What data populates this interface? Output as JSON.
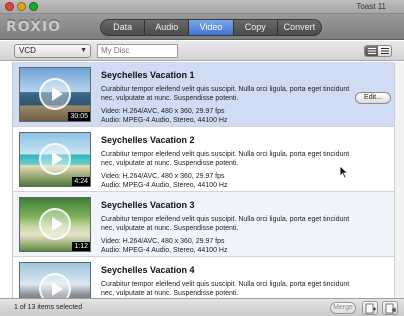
{
  "window": {
    "title": "Toast 11"
  },
  "toolbar": {
    "logo": "ROXIO",
    "tabs": [
      {
        "label": "Data",
        "active": false
      },
      {
        "label": "Audio",
        "active": false
      },
      {
        "label": "Video",
        "active": true
      },
      {
        "label": "Copy",
        "active": false
      },
      {
        "label": "Convert",
        "active": false
      }
    ]
  },
  "subbar": {
    "format_select": "VCD",
    "disc_name": "My Disc"
  },
  "items": [
    {
      "title": "Seychelles Vacation 1",
      "description": "Curabitur tempor eleifend velit quis suscipit. Nulla orci ligula, porta eget tincidunt nec, vulputate at nunc. Suspendisse potenti.",
      "video": "Video: H.264/AVC, 480 x 360, 29.97 fps",
      "audio": "Audio: MPEG-4 Audio, Stereo, 44100 Hz",
      "duration": "30:05",
      "selected": true,
      "edit_label": "Edit..."
    },
    {
      "title": "Seychelles Vacation 2",
      "description": "Curabitur tempor eleifend velit quis suscipit. Nulla orci ligula, porta eget tincidunt nec, vulputate at nunc. Suspendisse potenti.",
      "video": "Video: H.264/AVC, 480 x 360, 29.97 fps",
      "audio": "Audio: MPEG-4 Audio, Stereo, 44100 Hz",
      "duration": "4:24",
      "selected": false
    },
    {
      "title": "Seychelles Vacation 3",
      "description": "Curabitur tempor eleifend velit quis suscipit. Nulla orci ligula, porta eget tincidunt nec, vulputate at nunc. Suspendisse potenti.",
      "video": "Video: H.264/AVC, 480 x 360, 29.97 fps",
      "audio": "Audio: MPEG-4 Audio, Stereo, 44100 Hz",
      "duration": "1:12",
      "selected": false
    },
    {
      "title": "Seychelles Vacation 4",
      "description": "Curabitur tempor eleifend velit quis suscipit. Nulla orci ligula, porta eget tincidunt nec, vulputate at nunc. Suspendisse potenti.",
      "video": "",
      "audio": "",
      "duration": "",
      "selected": false
    }
  ],
  "statusbar": {
    "text": "1 of 13 items selected",
    "merge_label": "Merge"
  }
}
